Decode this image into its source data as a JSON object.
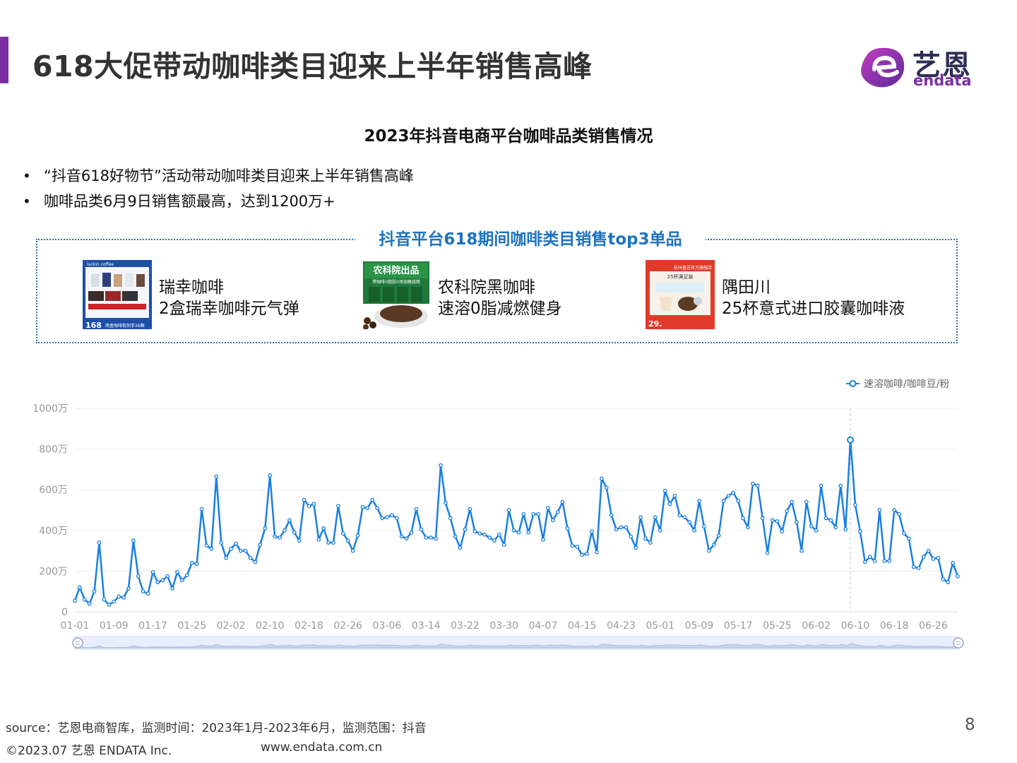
{
  "header": {
    "title": "618大促带动咖啡类目迎来上半年销售高峰",
    "logo_cn": "艺恩",
    "logo_en": "endata"
  },
  "chart_title": "2023年抖音电商平台咖啡品类销售情况",
  "bullets": [
    "“抖音618好物节”活动带动咖啡类目迎来上半年销售高峰",
    "咖啡品类6月9日销售额最高，达到1200万+"
  ],
  "top3": {
    "title": "抖音平台618期间咖啡类目销售top3单品",
    "products": [
      {
        "name": "瑞幸咖啡",
        "desc": "2盒瑞幸咖啡元气弹",
        "img_price": "168",
        "img_caption": "两盒咖啡粉到手36颗",
        "img_brand": "luckin coffee"
      },
      {
        "name": "农科院黑咖啡",
        "desc": "速溶0脂减燃健身",
        "img_banner": "农科院出品",
        "img_sub": "黑咖啡0脂肪0添加糖减燃"
      },
      {
        "name": "隅田川",
        "desc": "25杯意式进口胶囊咖啡液",
        "img_banner": "25杯满足装",
        "img_price": "29.",
        "img_shop": "杭州直送官方旗舰店"
      }
    ]
  },
  "chart_data": {
    "type": "line",
    "title": "",
    "xlabel": "",
    "ylabel": "",
    "ylim": [
      0,
      1000
    ],
    "yticks": [
      "0",
      "200万",
      "400万",
      "600万",
      "800万",
      "1000万"
    ],
    "ytick_values": [
      0,
      200,
      400,
      600,
      800,
      1000
    ],
    "unit": "万",
    "grid": true,
    "legend_position": "top-right",
    "highlight_x": "06-09",
    "x_tick_labels": [
      "01-01",
      "01-09",
      "01-17",
      "01-25",
      "02-02",
      "02-10",
      "02-18",
      "02-26",
      "03-06",
      "03-14",
      "03-22",
      "03-30",
      "04-07",
      "04-15",
      "04-23",
      "05-01",
      "05-09",
      "05-17",
      "05-25",
      "06-02",
      "06-10",
      "06-18",
      "06-26"
    ],
    "x_start": "2023-01-01",
    "x_end": "2023-06-30",
    "colors": {
      "line": "#1a7fe0",
      "grid": "#eeeeee",
      "axis_text": "#999999",
      "cursor": "#b8c8dc"
    },
    "series": [
      {
        "name": "速溶咖啡/咖啡豆/粉",
        "values": [
          55,
          120,
          60,
          40,
          100,
          340,
          60,
          35,
          50,
          75,
          70,
          115,
          350,
          175,
          100,
          90,
          195,
          145,
          155,
          175,
          115,
          195,
          155,
          180,
          240,
          235,
          505,
          325,
          310,
          665,
          340,
          265,
          310,
          335,
          300,
          300,
          265,
          245,
          330,
          410,
          670,
          370,
          365,
          400,
          450,
          390,
          350,
          550,
          520,
          530,
          355,
          410,
          340,
          340,
          520,
          385,
          350,
          300,
          375,
          515,
          510,
          550,
          510,
          460,
          465,
          475,
          460,
          370,
          360,
          390,
          505,
          405,
          365,
          365,
          360,
          720,
          535,
          460,
          370,
          315,
          405,
          505,
          395,
          385,
          380,
          365,
          350,
          380,
          330,
          500,
          400,
          390,
          480,
          390,
          480,
          480,
          355,
          510,
          450,
          490,
          540,
          410,
          325,
          320,
          280,
          285,
          395,
          293,
          655,
          610,
          475,
          405,
          415,
          415,
          370,
          315,
          465,
          360,
          340,
          465,
          400,
          595,
          530,
          570,
          475,
          465,
          440,
          400,
          545,
          420,
          300,
          330,
          375,
          545,
          570,
          585,
          545,
          460,
          415,
          630,
          620,
          460,
          290,
          450,
          445,
          395,
          495,
          540,
          440,
          300,
          540,
          420,
          400,
          620,
          460,
          450,
          415,
          620,
          405,
          845,
          525,
          395,
          245,
          270,
          250,
          500,
          250,
          250,
          500,
          480,
          385,
          360,
          220,
          215,
          270,
          300,
          260,
          265,
          160,
          145,
          240,
          175
        ],
        "color": "#1a7fe0"
      }
    ],
    "slider": {
      "type": "dataZoom",
      "range": "full"
    }
  },
  "footer": {
    "source": "source：艺恩电商智库，监测时间：2023年1月-2023年6月，监测范围：抖音",
    "copyright": "©2023.07 艺恩 ENDATA Inc.",
    "website": "www.endata.com.cn",
    "page_number": "8"
  }
}
